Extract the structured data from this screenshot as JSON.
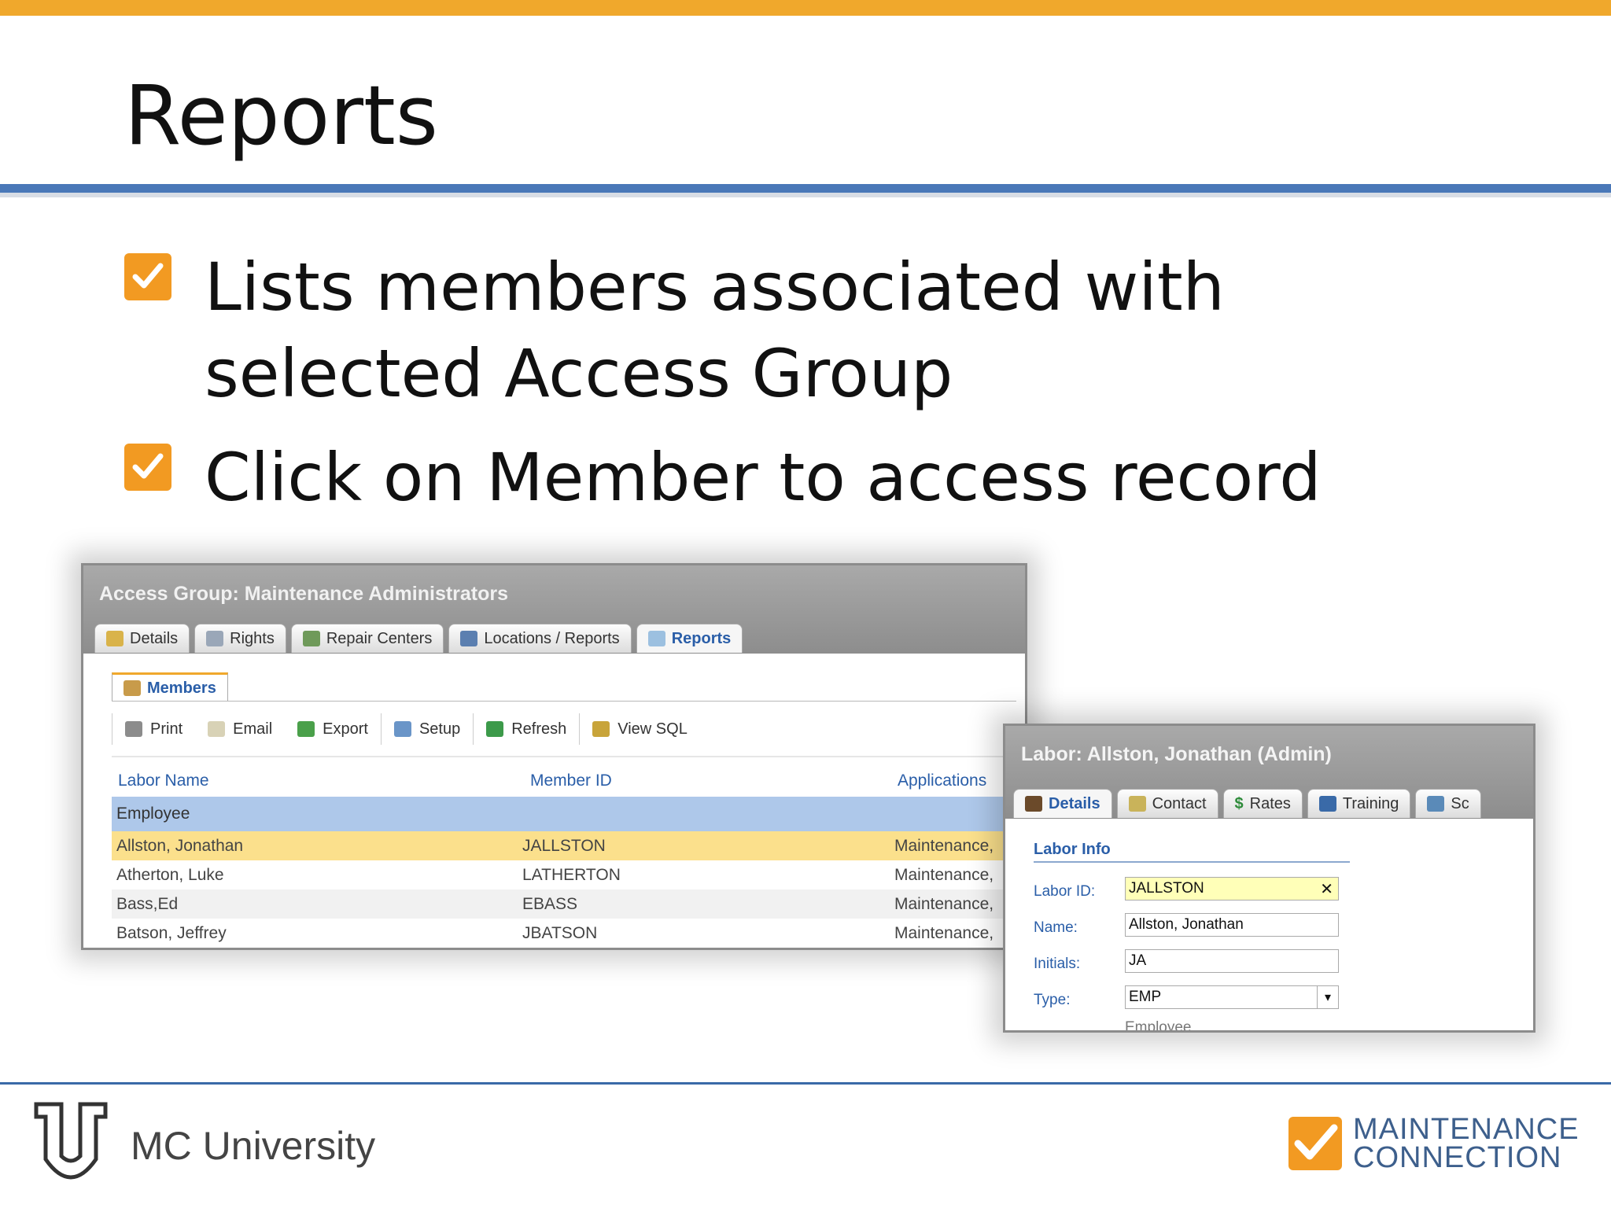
{
  "slide": {
    "title": "Reports",
    "bullets": [
      "Lists members associated with selected Access Group",
      "Click on Member to access record"
    ]
  },
  "access_group_window": {
    "title": "Access Group: Maintenance Administrators",
    "tabs": [
      "Details",
      "Rights",
      "Repair Centers",
      "Locations / Reports",
      "Reports"
    ],
    "active_tab": "Reports",
    "subtab": "Members",
    "toolbar": [
      "Print",
      "Email",
      "Export",
      "Setup",
      "Refresh",
      "View SQL"
    ],
    "columns": [
      "Labor Name",
      "Member ID",
      "Applications"
    ],
    "group": "Employee",
    "rows": [
      {
        "name": "Allston, Jonathan",
        "id": "JALLSTON",
        "app": "Maintenance,"
      },
      {
        "name": "Atherton, Luke",
        "id": "LATHERTON",
        "app": "Maintenance,"
      },
      {
        "name": "Bass,Ed",
        "id": "EBASS",
        "app": "Maintenance,"
      },
      {
        "name": "Batson, Jeffrey",
        "id": "JBATSON",
        "app": "Maintenance,"
      }
    ]
  },
  "labor_window": {
    "title": "Labor: Allston, Jonathan  (Admin)",
    "tabs": [
      "Details",
      "Contact",
      "Rates",
      "Training",
      "Sc"
    ],
    "active_tab": "Details",
    "section": "Labor Info",
    "fields": {
      "labor_id_label": "Labor ID:",
      "labor_id": "JALLSTON",
      "name_label": "Name:",
      "name": "Allston, Jonathan",
      "initials_label": "Initials:",
      "initials": "JA",
      "type_label": "Type:",
      "type": "EMP"
    },
    "cut_text": "Employee"
  },
  "footer": {
    "brand": "MC University",
    "logo_line1": "MAINTENANCE",
    "logo_line2": "CONNECTION"
  },
  "colors": {
    "accent_orange": "#f0a82c",
    "rule_blue": "#4a78b8",
    "selected_row": "#fbe08c",
    "group_row": "#aec8ea"
  }
}
